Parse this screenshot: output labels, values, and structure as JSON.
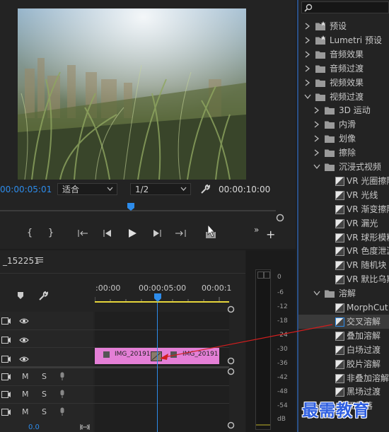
{
  "monitor": {
    "playhead_timecode": "00:00:05:01",
    "fit_label": "适合",
    "resolution_label": "1/2",
    "duration_timecode": "00:00:10:00",
    "transport": [
      "{",
      "}",
      "{←",
      "◀|",
      "▶",
      "|▶",
      "→}"
    ]
  },
  "timeline": {
    "sequence_name": "_152251",
    "ruler_labels": [
      ":00:00",
      "00:00:05:00",
      "00:00:1"
    ],
    "video_tracks": 3,
    "audio_track_labels": {
      "mute": "M",
      "solo": "S"
    },
    "clip_left": "IMG_20191",
    "clip_right": "IMG_20191",
    "clip_color": "#e47fd6",
    "playhead_color": "#2d8ceb",
    "footer_value": "0.0"
  },
  "meters": {
    "db_labels": [
      "0",
      "-6",
      "-12",
      "-18",
      "-24",
      "-30",
      "-36",
      "-42",
      "-48",
      "-54",
      "dB"
    ]
  },
  "effects": {
    "search_placeholder": "",
    "items": [
      {
        "label": "预设",
        "level": 0,
        "type": "folder-star",
        "expanded": false
      },
      {
        "label": "Lumetri 预设",
        "level": 0,
        "type": "folder-star",
        "expanded": false
      },
      {
        "label": "音频效果",
        "level": 0,
        "type": "folder",
        "expanded": false
      },
      {
        "label": "音频过渡",
        "level": 0,
        "type": "folder",
        "expanded": false
      },
      {
        "label": "视频效果",
        "level": 0,
        "type": "folder",
        "expanded": false
      },
      {
        "label": "视频过渡",
        "level": 0,
        "type": "folder",
        "expanded": true
      },
      {
        "label": "3D 运动",
        "level": 1,
        "type": "folder",
        "expanded": false
      },
      {
        "label": "内滑",
        "level": 1,
        "type": "folder",
        "expanded": false
      },
      {
        "label": "划像",
        "level": 1,
        "type": "folder",
        "expanded": false
      },
      {
        "label": "擦除",
        "level": 1,
        "type": "folder",
        "expanded": false
      },
      {
        "label": "沉浸式视频",
        "level": 1,
        "type": "folder",
        "expanded": true
      },
      {
        "label": "VR 光圈擦除",
        "level": 2,
        "type": "effect"
      },
      {
        "label": "VR 光线",
        "level": 2,
        "type": "effect"
      },
      {
        "label": "VR 渐变擦除",
        "level": 2,
        "type": "effect"
      },
      {
        "label": "VR 漏光",
        "level": 2,
        "type": "effect"
      },
      {
        "label": "VR 球形模糊",
        "level": 2,
        "type": "effect"
      },
      {
        "label": "VR 色度泄漏",
        "level": 2,
        "type": "effect"
      },
      {
        "label": "VR 随机块",
        "level": 2,
        "type": "effect"
      },
      {
        "label": "VR 默比乌斯",
        "level": 2,
        "type": "effect"
      },
      {
        "label": "溶解",
        "level": 1,
        "type": "folder",
        "expanded": true
      },
      {
        "label": "MorphCut",
        "level": 2,
        "type": "effect"
      },
      {
        "label": "交叉溶解",
        "level": 2,
        "type": "effect",
        "selected": true
      },
      {
        "label": "叠加溶解",
        "level": 2,
        "type": "effect"
      },
      {
        "label": "白场过渡",
        "level": 2,
        "type": "effect"
      },
      {
        "label": "胶片溶解",
        "level": 2,
        "type": "effect"
      },
      {
        "label": "非叠加溶解",
        "level": 2,
        "type": "effect"
      },
      {
        "label": "黑场过渡",
        "level": 2,
        "type": "effect"
      },
      {
        "label": "页面剥落",
        "level": 1,
        "type": "folder",
        "expanded": false
      }
    ]
  },
  "watermark": "最需教育"
}
